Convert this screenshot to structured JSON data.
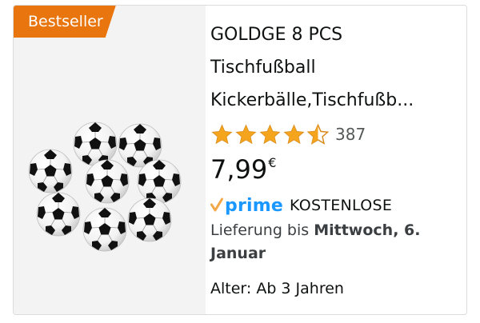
{
  "badge": {
    "label": "Bestseller",
    "color": "#e8750d"
  },
  "product": {
    "title_lines": [
      "GOLDGE 8 PCS",
      "Tischfußball",
      "Kickerbälle,Tischfußb..."
    ],
    "image_icon": "foosball-balls-image",
    "rating": 4.5,
    "review_count": "387",
    "price_main": "7,99",
    "price_currency": "€",
    "prime_label": "prime",
    "shipping_label": "KOSTENLOSE",
    "delivery_prefix": "Lieferung bis ",
    "delivery_date": "Mittwoch, 6. Januar",
    "age_label": "Alter: Ab 3 Jahren"
  },
  "colors": {
    "star": "#f4a41d",
    "prime_blue": "#1a98ff",
    "prime_check": "#f3a847"
  }
}
